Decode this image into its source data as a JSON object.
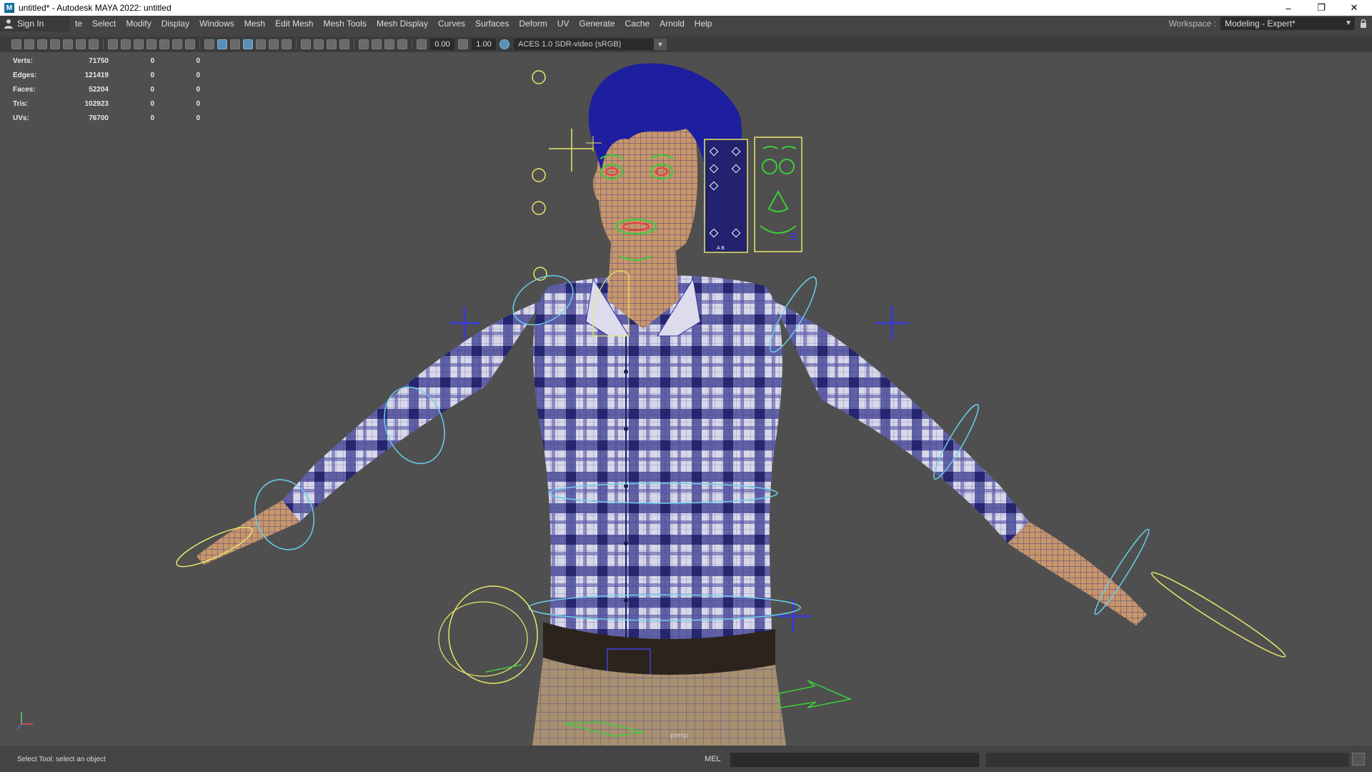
{
  "window": {
    "title": "untitled* - Autodesk MAYA 2022: untitled",
    "app_icon": "maya-icon",
    "minimize_glyph": "–",
    "restore_glyph": "❐",
    "close_glyph": "✕"
  },
  "menubar": {
    "sign_in": "Sign In",
    "items": [
      "te",
      "Select",
      "Modify",
      "Display",
      "Windows",
      "Mesh",
      "Edit Mesh",
      "Mesh Tools",
      "Mesh Display",
      "Curves",
      "Surfaces",
      "Deform",
      "UV",
      "Generate",
      "Cache",
      "Arnold",
      "Help"
    ]
  },
  "workspace": {
    "label": "Workspace :",
    "value": "Modeling - Expert*"
  },
  "toolbar": {
    "field_a": "0.00",
    "field_b": "1.00",
    "color_space": "ACES 1.0 SDR-video (sRGB)"
  },
  "hud": {
    "rows": [
      {
        "label": "Verts:",
        "v1": "71750",
        "v2": "0",
        "v3": "0"
      },
      {
        "label": "Edges:",
        "v1": "121419",
        "v2": "0",
        "v3": "0"
      },
      {
        "label": "Faces:",
        "v1": "52204",
        "v2": "0",
        "v3": "0"
      },
      {
        "label": "Tris:",
        "v1": "102923",
        "v2": "0",
        "v3": "0"
      },
      {
        "label": "UVs:",
        "v1": "76700",
        "v2": "0",
        "v3": "0"
      }
    ]
  },
  "viewport": {
    "camera": "persp",
    "face_panel_mark": "A B"
  },
  "statusbar": {
    "help_line": "Select Tool: select an object",
    "command_language": "MEL"
  },
  "colors": {
    "wire": "#2a2a9a",
    "shirt_light": "#d6d6e8",
    "skin": "#c99a6e",
    "ctrl_yellow": "#e8e86a",
    "ctrl_cyan": "#6ad0e8",
    "ctrl_blue": "#3a3ad0",
    "ctrl_green": "#3ad03a"
  }
}
